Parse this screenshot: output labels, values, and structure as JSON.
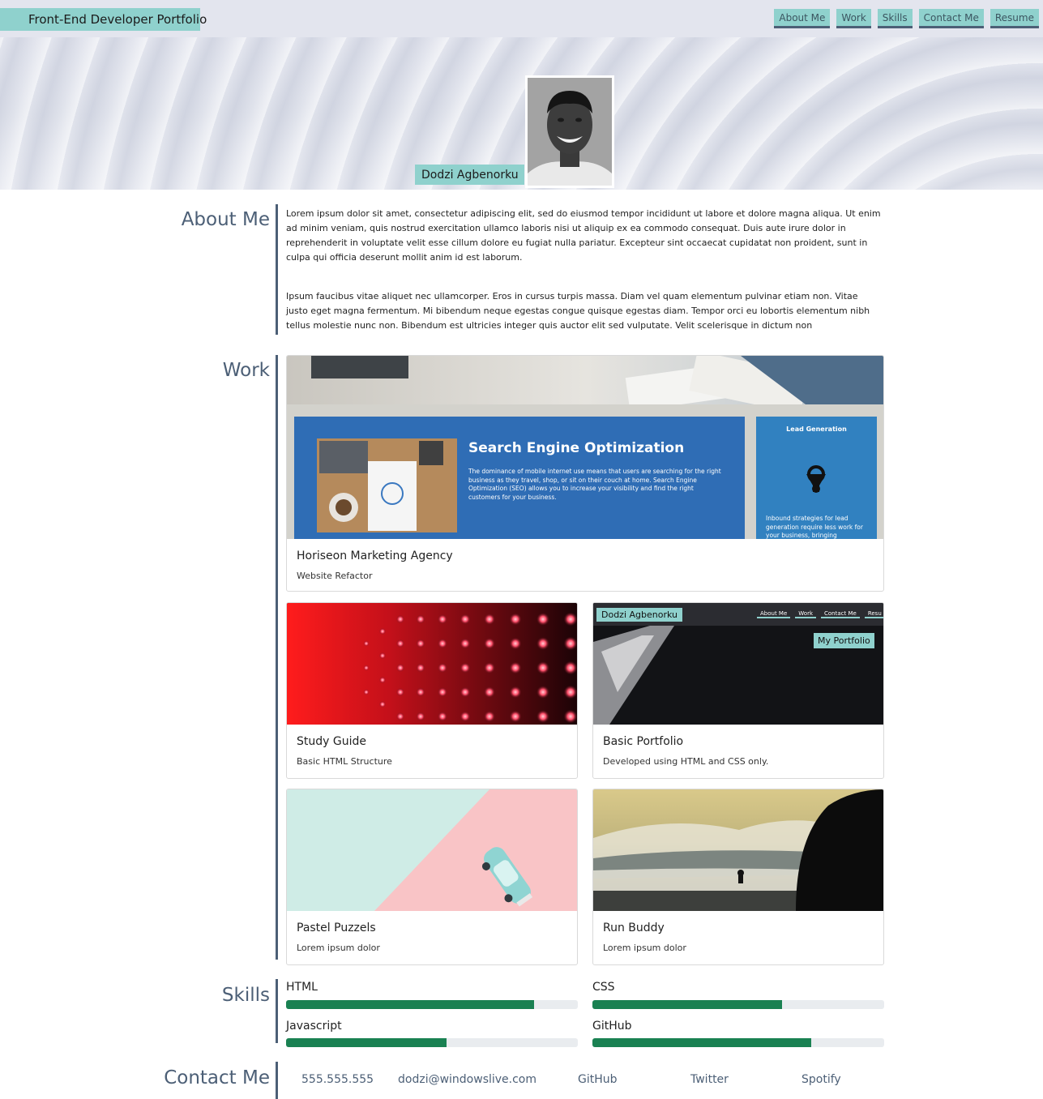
{
  "header": {
    "brand": "Front-End Developer Portfolio",
    "nav": [
      "About Me",
      "Work",
      "Skills",
      "Contact Me",
      "Resume"
    ],
    "name": "Dodzi Agbenorku"
  },
  "about": {
    "title": "About Me",
    "paragraphs": [
      "Lorem ipsum dolor sit amet, consectetur adipiscing elit, sed do eiusmod tempor incididunt ut labore et dolore magna aliqua. Ut enim ad minim veniam, quis nostrud exercitation ullamco laboris nisi ut aliquip ex ea commodo consequat. Duis aute irure dolor in reprehenderit in voluptate velit esse cillum dolore eu fugiat nulla pariatur. Excepteur sint occaecat cupidatat non proident, sunt in culpa qui officia deserunt mollit anim id est laborum.",
      "Ipsum faucibus vitae aliquet nec ullamcorper. Eros in cursus turpis massa. Diam vel quam elementum pulvinar etiam non. Vitae justo eget magna fermentum. Mi bibendum neque egestas congue quisque egestas diam. Tempor orci eu lobortis elementum nibh tellus molestie nunc non. Bibendum est ultricies integer quis auctor elit sed vulputate. Velit scelerisque in dictum non"
    ]
  },
  "work": {
    "title": "Work",
    "projects": [
      {
        "title": "Horiseon Marketing Agency",
        "subtitle": "Website Refactor",
        "preview": {
          "seo_heading": "Search Engine Optimization",
          "seo_body": "The dominance of mobile internet use means that users are searching for the right business as they travel, shop, or sit on their couch at home. Search Engine Optimization (SEO) allows you to increase your visibility and find the right customers for your business.",
          "lead_heading": "Lead Generation",
          "lead_body": "Inbound strategies for lead generation require less work for your business, bringing"
        }
      },
      {
        "title": "Study Guide",
        "subtitle": "Basic HTML Structure"
      },
      {
        "title": "Basic Portfolio",
        "subtitle": "Developed using HTML and CSS only.",
        "preview": {
          "name": "Dodzi Agbenorku",
          "nav": [
            "About Me",
            "Work",
            "Contact Me",
            "Resu"
          ],
          "badge": "My Portfolio"
        }
      },
      {
        "title": "Pastel Puzzels",
        "subtitle": "Lorem ipsum dolor"
      },
      {
        "title": "Run Buddy",
        "subtitle": "Lorem ipsum dolor"
      }
    ]
  },
  "skills": {
    "title": "Skills",
    "items": [
      {
        "name": "HTML",
        "level": 0.85
      },
      {
        "name": "CSS",
        "level": 0.65
      },
      {
        "name": "Javascript",
        "level": 0.55
      },
      {
        "name": "GitHub",
        "level": 0.75
      }
    ]
  },
  "contact": {
    "title": "Contact Me",
    "items": [
      "555.555.555",
      "dodzi@windowslive.com",
      "GitHub",
      "Twitter",
      "Spotify"
    ]
  },
  "colors": {
    "accent_teal": "#8fd1cd",
    "slate": "#4c5f76",
    "progress_green": "#1a8152"
  }
}
